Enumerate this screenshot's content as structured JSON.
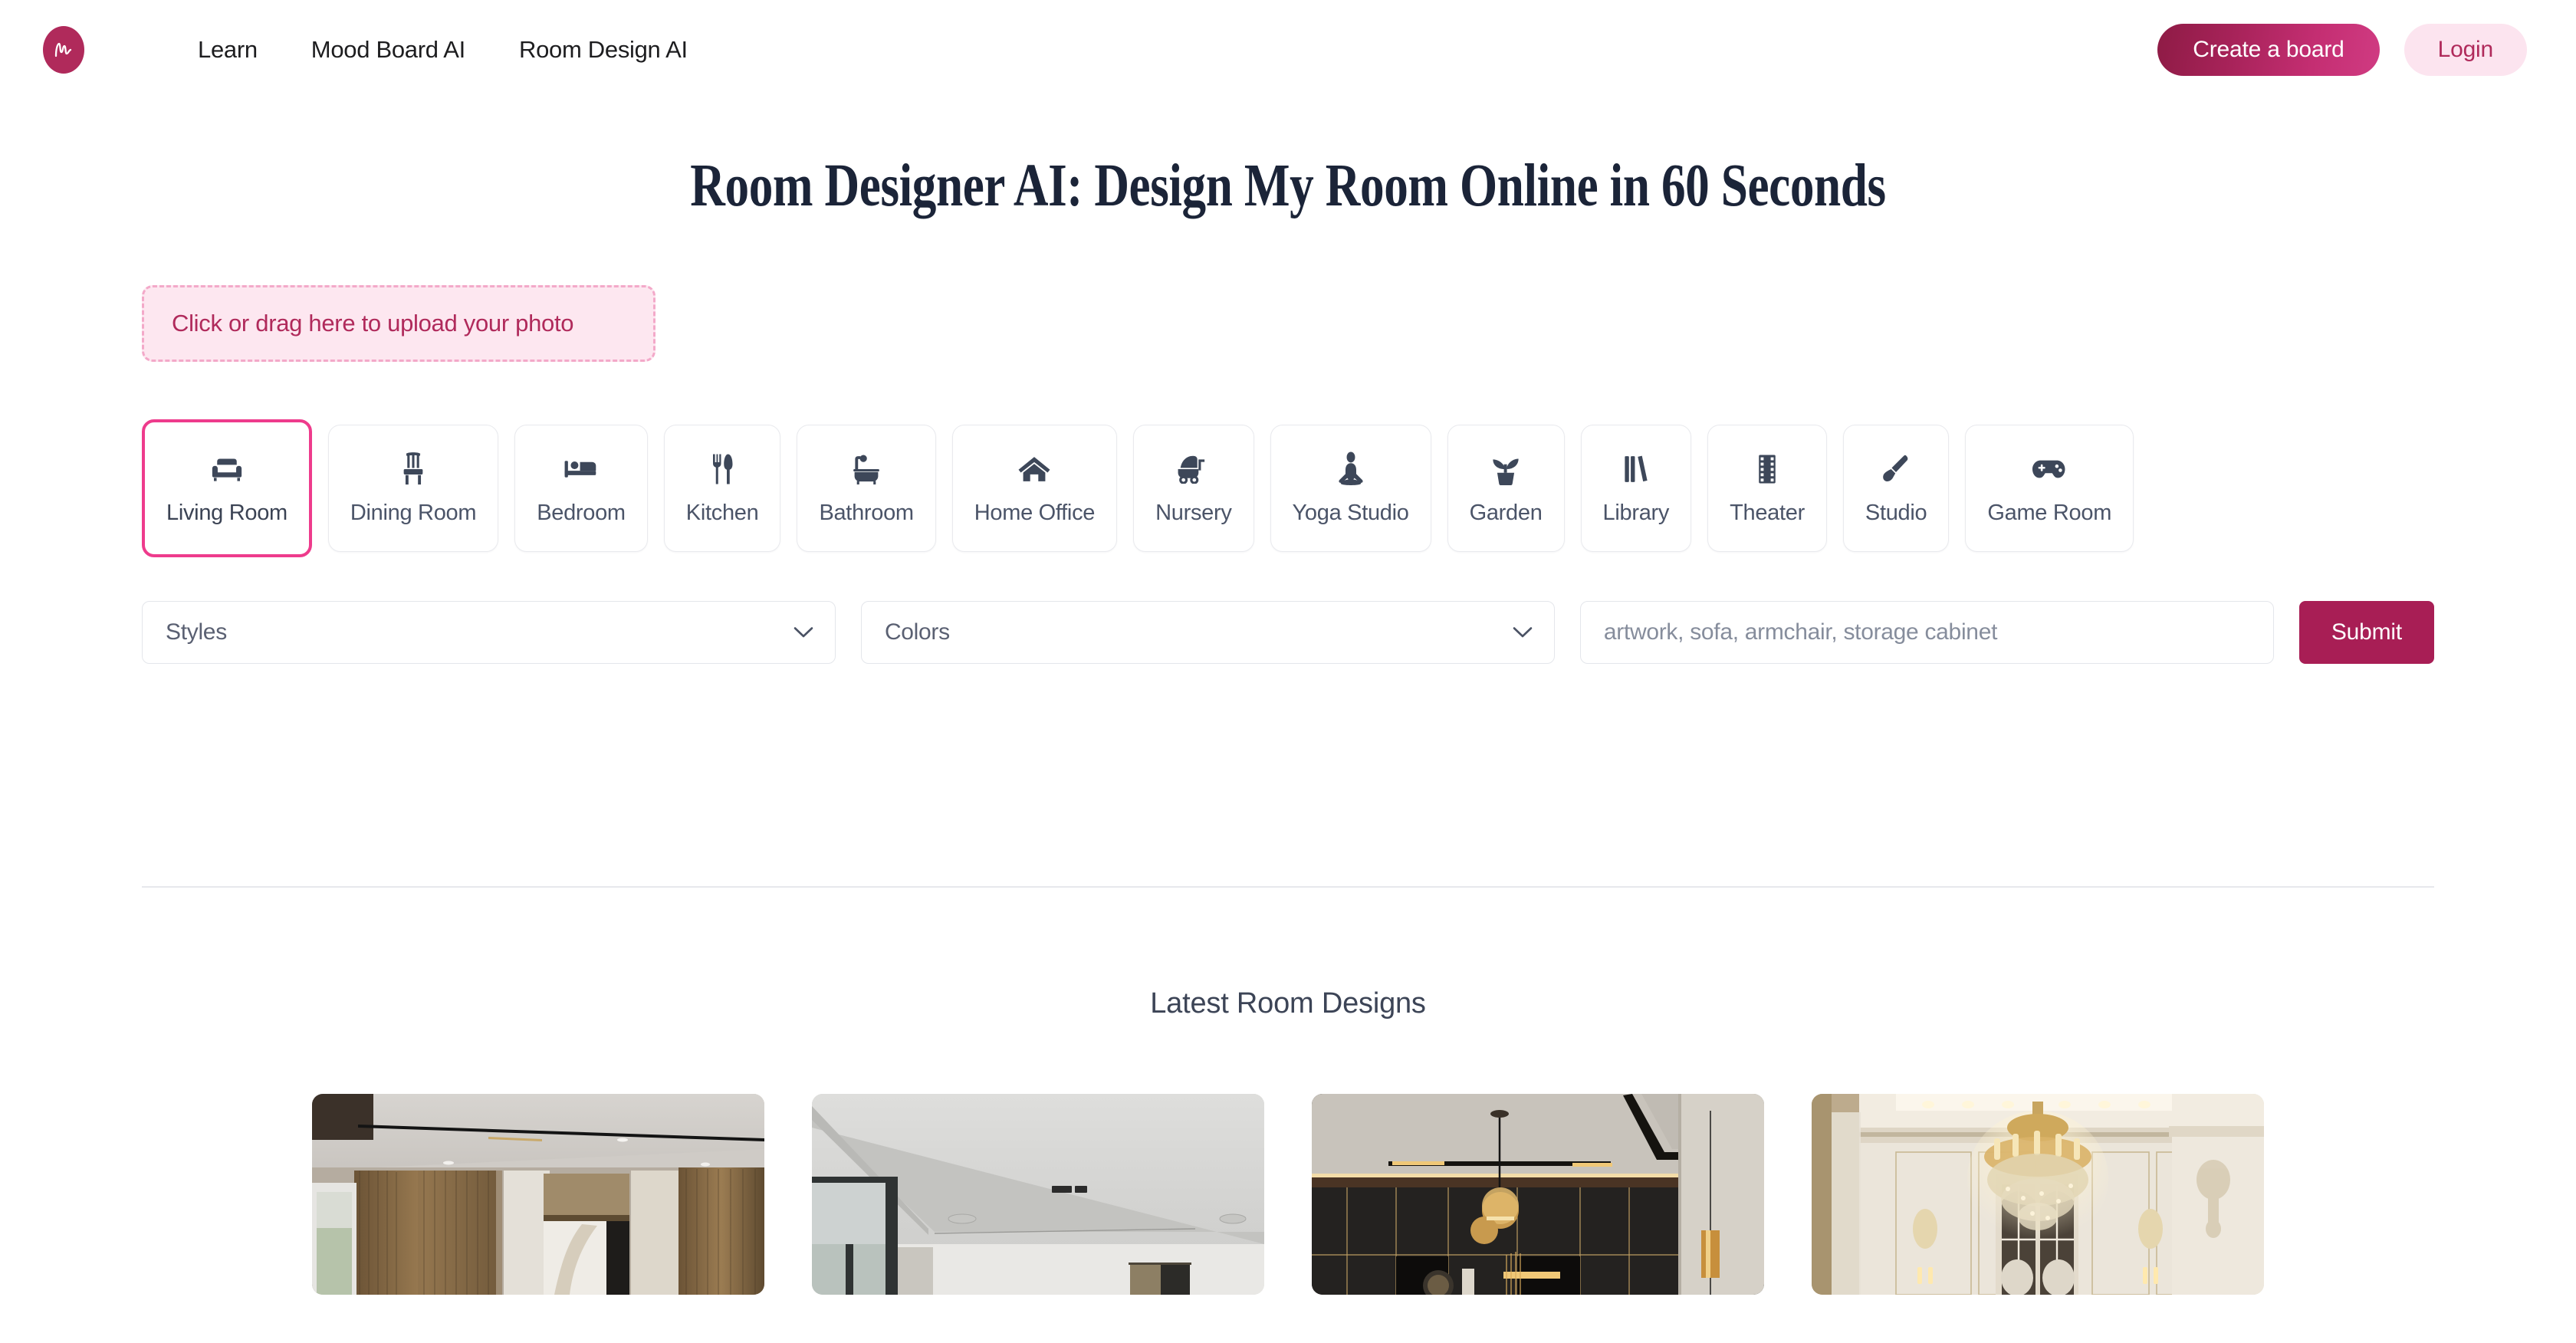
{
  "brand": {
    "logo_icon": "monogram-m-logo",
    "accent_pink": "#EE3B8C",
    "accent_maroon": "#A81E55",
    "accent_soft_pink": "#FCE4EF"
  },
  "header": {
    "nav": [
      {
        "label": "Learn",
        "name": "nav-link-learn"
      },
      {
        "label": "Mood Board AI",
        "name": "nav-link-mood-board-ai"
      },
      {
        "label": "Room Design AI",
        "name": "nav-link-room-design-ai"
      }
    ],
    "create_board_label": "Create a board",
    "login_label": "Login"
  },
  "main": {
    "title": "Room Designer AI: Design My Room Online in 60 Seconds",
    "dropzone_label": "Click or drag here to upload your photo",
    "room_types": [
      {
        "label": "Living Room",
        "icon": "couch-icon",
        "selected": true
      },
      {
        "label": "Dining Room",
        "icon": "chair-icon",
        "selected": false
      },
      {
        "label": "Bedroom",
        "icon": "bed-icon",
        "selected": false
      },
      {
        "label": "Kitchen",
        "icon": "utensils-icon",
        "selected": false
      },
      {
        "label": "Bathroom",
        "icon": "bathtub-icon",
        "selected": false
      },
      {
        "label": "Home Office",
        "icon": "house-icon",
        "selected": false
      },
      {
        "label": "Nursery",
        "icon": "baby-carriage-icon",
        "selected": false
      },
      {
        "label": "Yoga Studio",
        "icon": "meditation-icon",
        "selected": false
      },
      {
        "label": "Garden",
        "icon": "potted-plant-icon",
        "selected": false
      },
      {
        "label": "Library",
        "icon": "books-icon",
        "selected": false
      },
      {
        "label": "Theater",
        "icon": "film-strip-icon",
        "selected": false
      },
      {
        "label": "Studio",
        "icon": "paintbrush-icon",
        "selected": false
      },
      {
        "label": "Game Room",
        "icon": "gamepad-icon",
        "selected": false
      }
    ],
    "form": {
      "styles_value": "Styles",
      "colors_value": "Colors",
      "items_placeholder": "artwork, sofa, armchair, storage cabinet",
      "items_value": "",
      "submit_label": "Submit"
    }
  },
  "latest": {
    "heading": "Latest Room Designs",
    "cards": [
      {
        "name": "room-design-card-1",
        "alt": "modern room with brown vertical curtains and recessed ceiling lighting"
      },
      {
        "name": "room-design-card-2",
        "alt": "bright minimal room with white ceiling and large glass window"
      },
      {
        "name": "room-design-card-3",
        "alt": "dark cabinetry room with gold trim and spherical pendant lights"
      },
      {
        "name": "room-design-card-4",
        "alt": "classical room with crystal chandelier and cream wall panelling"
      }
    ]
  }
}
